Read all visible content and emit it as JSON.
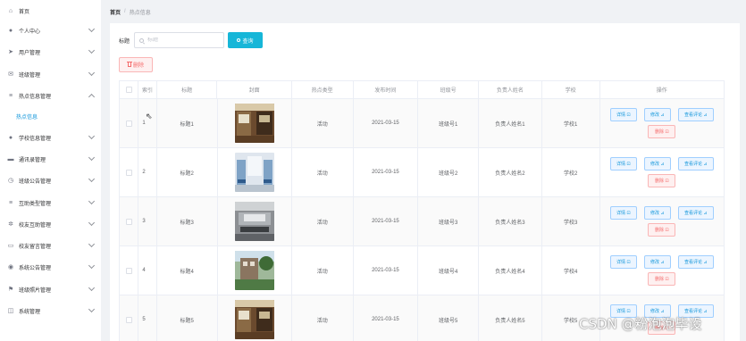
{
  "breadcrumb": {
    "home": "首页",
    "separator": "/",
    "current": "热点信息"
  },
  "sidebar": {
    "items": [
      {
        "label": "首页",
        "icon": "home-icon",
        "glyph": "⌂",
        "chevron": ""
      },
      {
        "label": "个人中心",
        "icon": "user-icon",
        "glyph": "●",
        "chevron": "down"
      },
      {
        "label": "用户管理",
        "icon": "send-icon",
        "glyph": "➤",
        "chevron": "down"
      },
      {
        "label": "班级管理",
        "icon": "message-icon",
        "glyph": "✉",
        "chevron": "down"
      },
      {
        "label": "热点信息管理",
        "icon": "menu-icon",
        "glyph": "≡",
        "chevron": "up"
      },
      {
        "label": "学校信息管理",
        "icon": "user-icon",
        "glyph": "●",
        "chevron": "down"
      },
      {
        "label": "通讯录管理",
        "icon": "folder-icon",
        "glyph": "▬",
        "chevron": "down"
      },
      {
        "label": "班级公告管理",
        "icon": "clock-icon",
        "glyph": "◷",
        "chevron": "down"
      },
      {
        "label": "互助类型管理",
        "icon": "menu-icon",
        "glyph": "≡",
        "chevron": "down"
      },
      {
        "label": "校友互助管理",
        "icon": "settings-icon",
        "glyph": "✲",
        "chevron": "down"
      },
      {
        "label": "校友留言管理",
        "icon": "chat-icon",
        "glyph": "▭",
        "chevron": "down"
      },
      {
        "label": "系统公告管理",
        "icon": "compass-icon",
        "glyph": "◉",
        "chevron": "down"
      },
      {
        "label": "班级照片管理",
        "icon": "flag-icon",
        "glyph": "⚑",
        "chevron": "down"
      },
      {
        "label": "系统管理",
        "icon": "cube-icon",
        "glyph": "◫",
        "chevron": "down"
      }
    ],
    "sub_item": {
      "label": "热点信息"
    }
  },
  "search": {
    "label": "标题",
    "placeholder": "标题",
    "button_label": "查询"
  },
  "toolbar": {
    "delete_label": "删除"
  },
  "table": {
    "headers": [
      "索引",
      "标题",
      "封面",
      "热点类型",
      "发布时间",
      "班级号",
      "负责人姓名",
      "学校",
      "操作"
    ],
    "rows": [
      {
        "index": "1",
        "title": "标题1",
        "type": "活动",
        "time": "2021-03-15",
        "class_no": "班级号1",
        "owner": "负责人姓名1",
        "school": "学校1"
      },
      {
        "index": "2",
        "title": "标题2",
        "type": "活动",
        "time": "2021-03-15",
        "class_no": "班级号2",
        "owner": "负责人姓名2",
        "school": "学校2"
      },
      {
        "index": "3",
        "title": "标题3",
        "type": "活动",
        "time": "2021-03-15",
        "class_no": "班级号3",
        "owner": "负责人姓名3",
        "school": "学校3"
      },
      {
        "index": "4",
        "title": "标题4",
        "type": "活动",
        "time": "2021-03-15",
        "class_no": "班级号4",
        "owner": "负责人姓名4",
        "school": "学校4"
      },
      {
        "index": "5",
        "title": "标题5",
        "type": "活动",
        "time": "2021-03-15",
        "class_no": "班级号5",
        "owner": "负责人姓名5",
        "school": "学校5"
      }
    ],
    "actions": {
      "detail": "详情 ⊡",
      "edit": "修改 ⊿",
      "review": "查看评论 ⊿",
      "delete": "删除 ⊡"
    }
  },
  "watermark": "CSDN @粉泡泡毕设",
  "colors": {
    "accent": "#1296db",
    "primary_button": "#16b6d8",
    "danger": "#f56c6c"
  }
}
